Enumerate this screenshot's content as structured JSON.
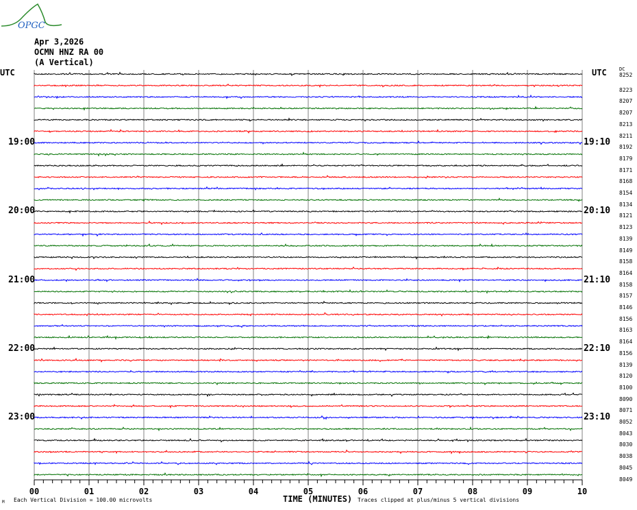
{
  "header": {
    "logo_text": "OPGC",
    "date": "Apr 3,2026",
    "station": "OCMN HNZ RA 00",
    "component": "(A Vertical)"
  },
  "utc_left": "UTC",
  "utc_right": "UTC",
  "dc_label": "DC",
  "colors": {
    "trace": [
      "#000000",
      "#ff0000",
      "#0000ff",
      "#007000"
    ],
    "grid": "#808080"
  },
  "chart_data": {
    "type": "line",
    "title": "OCMN HNZ RA 00 (A Vertical) Apr 3,2026",
    "xlabel": "TIME (MINUTES)",
    "x_ticks": [
      "00",
      "01",
      "02",
      "03",
      "04",
      "05",
      "06",
      "07",
      "08",
      "09",
      "10"
    ],
    "xlim": [
      0,
      10
    ],
    "rows": 36,
    "left_hour_labels": [
      {
        "row": 6,
        "label": "19:00"
      },
      {
        "row": 12,
        "label": "20:00"
      },
      {
        "row": 18,
        "label": "21:00"
      },
      {
        "row": 24,
        "label": "22:00"
      },
      {
        "row": 30,
        "label": "23:00"
      }
    ],
    "right_hour_labels": [
      {
        "row": 6,
        "label": "19:10"
      },
      {
        "row": 12,
        "label": "20:10"
      },
      {
        "row": 18,
        "label": "21:10"
      },
      {
        "row": 24,
        "label": "22:10"
      },
      {
        "row": 30,
        "label": "23:10"
      }
    ],
    "dc_offsets": [
      "8252",
      "8223",
      "8207",
      "8207",
      "8213",
      "8211",
      "8192",
      "8179",
      "8171",
      "8168",
      "8154",
      "8134",
      "8121",
      "8123",
      "8139",
      "8149",
      "8158",
      "8164",
      "8158",
      "8157",
      "8146",
      "8156",
      "8163",
      "8164",
      "8156",
      "8139",
      "8120",
      "8100",
      "8090",
      "8071",
      "8052",
      "8043",
      "8030",
      "8038",
      "8045",
      "8049"
    ]
  },
  "footer": {
    "corner": "M",
    "scale": "Each Vertical Division =  100.00 microvolts",
    "clip": "Traces clipped at plus/minus 5 vertical divisions"
  }
}
